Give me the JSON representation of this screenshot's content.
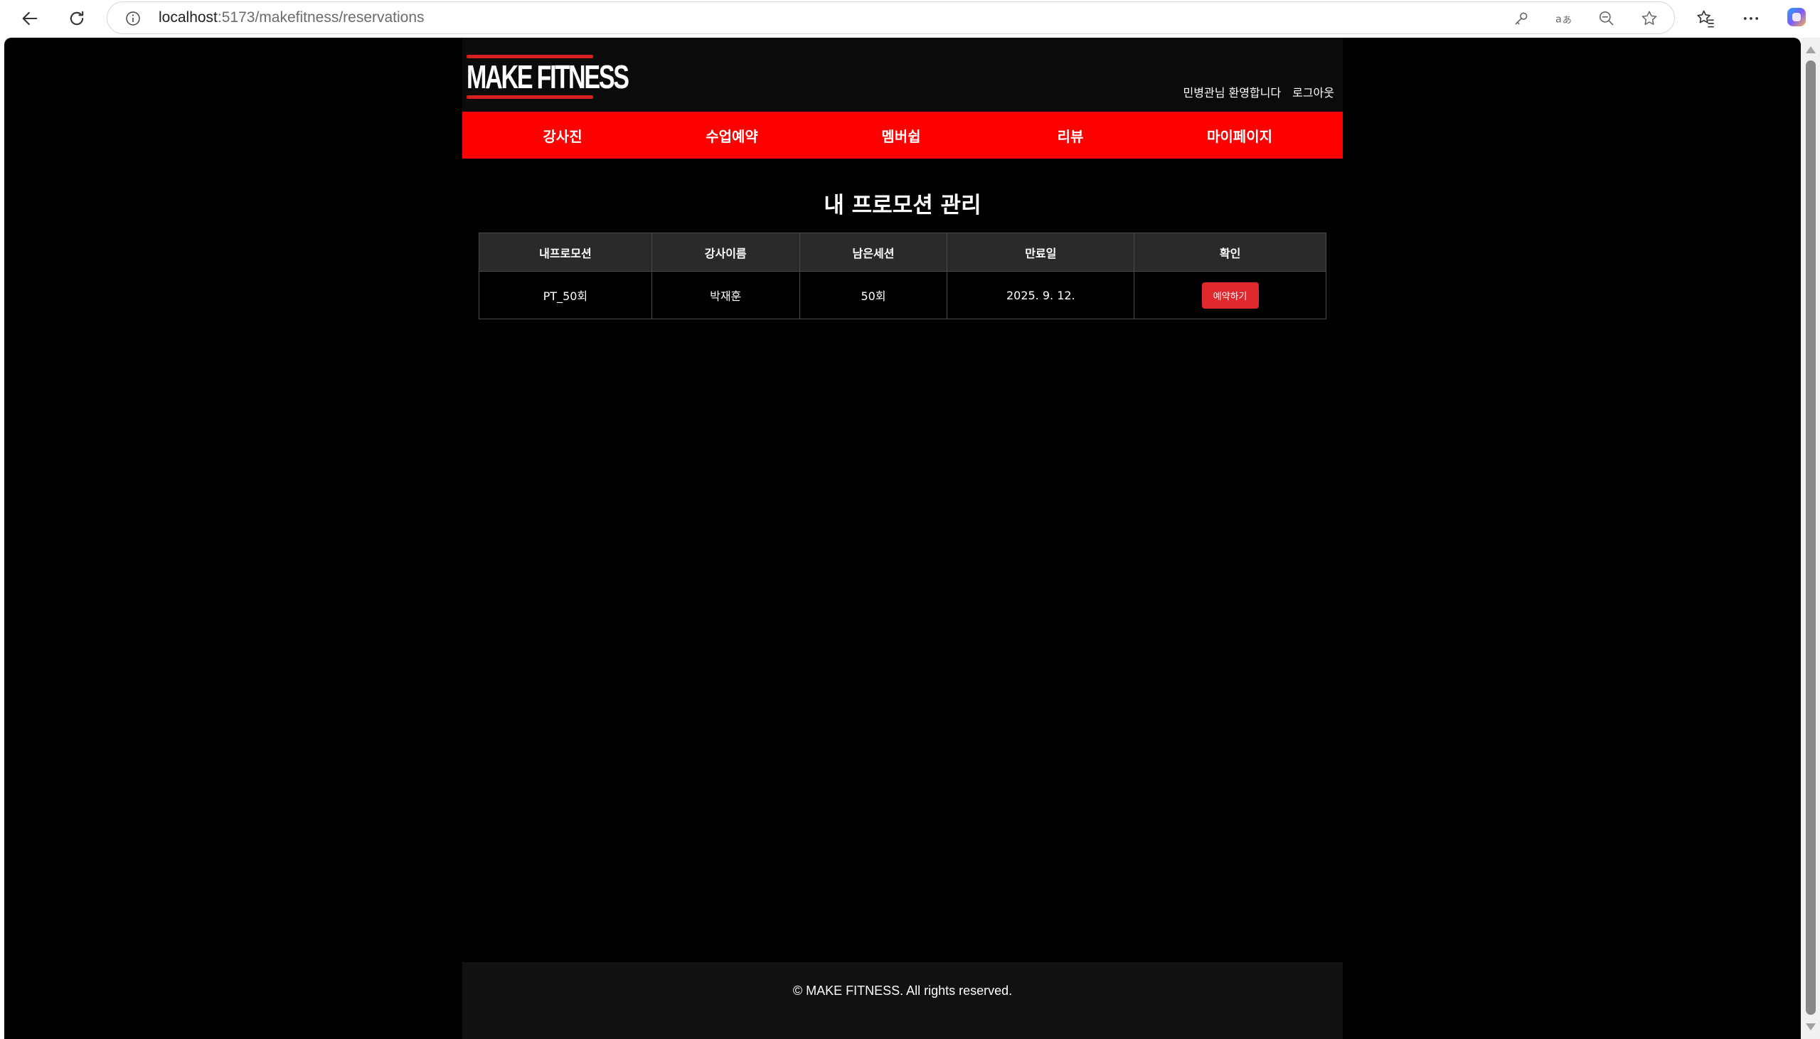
{
  "browser": {
    "url_host": "localhost",
    "url_rest": ":5173/makefitness/reservations"
  },
  "header": {
    "logo_text": "MAKE FITNESS",
    "welcome": "민병관님 환영합니다",
    "logout_label": "로그아웃"
  },
  "nav": {
    "items": [
      {
        "label": "강사진"
      },
      {
        "label": "수업예약"
      },
      {
        "label": "멤버쉽"
      },
      {
        "label": "리뷰"
      },
      {
        "label": "마이페이지"
      }
    ]
  },
  "main": {
    "title": "내 프로모션 관리",
    "table": {
      "columns": [
        "내프로모션",
        "강사이름",
        "남은세션",
        "만료일",
        "확인"
      ],
      "rows": [
        {
          "promotion": "PT_50회",
          "trainer": "박재훈",
          "remaining": "50회",
          "expiry": "2025. 9. 12.",
          "action_label": "예약하기"
        }
      ]
    }
  },
  "footer": {
    "copyright": "© MAKE FITNESS. All rights reserved."
  },
  "colors": {
    "brand_red": "#ff0000",
    "button_red": "#e0282f",
    "background": "#000000"
  }
}
